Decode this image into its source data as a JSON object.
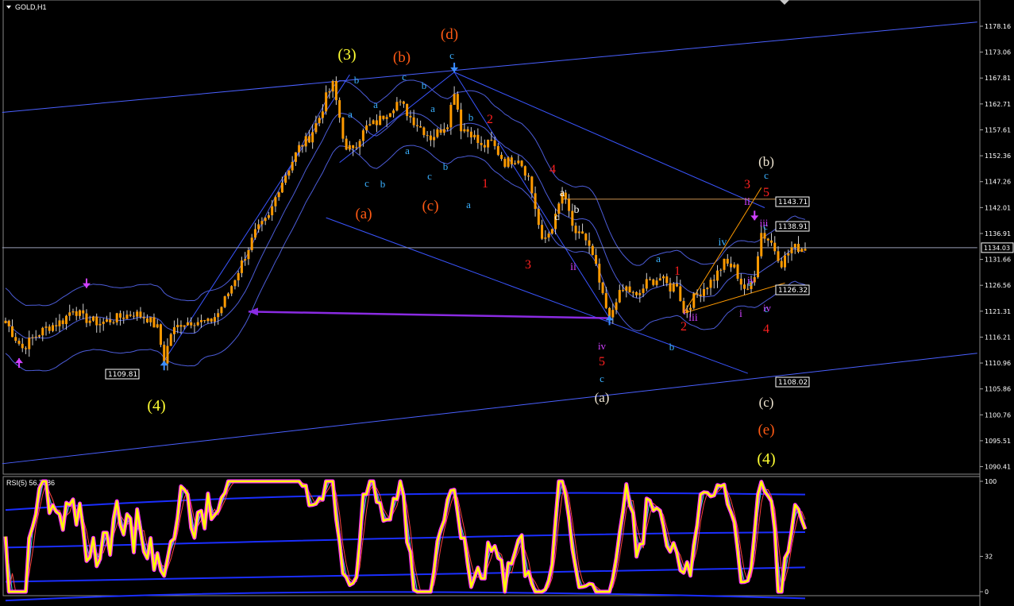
{
  "window": {
    "symbol_label": "GOLD,H1",
    "rsi_label": "RSI(5) 56.7186"
  },
  "chart_data": [
    {
      "type": "candlestick",
      "title": "GOLD,H1",
      "price_axis_ticks": [
        "1178.16",
        "1173.06",
        "1167.81",
        "1162.71",
        "1157.61",
        "1152.36",
        "1147.26",
        "1142.01",
        "1136.91",
        "1131.66",
        "1126.56",
        "1121.31",
        "1116.21",
        "1110.96",
        "1105.86",
        "1100.76",
        "1095.51",
        "1090.41"
      ],
      "ylim": [
        1090.41,
        1181.0
      ],
      "current_price": "1134.03",
      "price_tags": [
        "1143.71",
        "1138.91",
        "1126.32",
        "1109.81",
        "1108.02"
      ],
      "close_path": [
        [
          0,
          1119.5
        ],
        [
          2,
          1117
        ],
        [
          5,
          1114
        ],
        [
          8,
          1116
        ],
        [
          12,
          1118
        ],
        [
          17,
          1119.5
        ],
        [
          20,
          1122
        ],
        [
          23,
          1120
        ],
        [
          28,
          1119
        ],
        [
          33,
          1120
        ],
        [
          38,
          1121
        ],
        [
          42,
          1120
        ],
        [
          45,
          1118
        ],
        [
          47,
          1111.5
        ],
        [
          49,
          1117
        ],
        [
          52,
          1119
        ],
        [
          56,
          1119.5
        ],
        [
          60,
          1119
        ],
        [
          63,
          1121
        ],
        [
          66,
          1125
        ],
        [
          70,
          1131
        ],
        [
          74,
          1137
        ],
        [
          78,
          1140
        ],
        [
          81,
          1146
        ],
        [
          84,
          1150
        ],
        [
          87,
          1154
        ],
        [
          90,
          1156
        ],
        [
          93,
          1160
        ],
        [
          95,
          1164
        ],
        [
          97,
          1166.5
        ],
        [
          99,
          1160
        ],
        [
          101,
          1153
        ],
        [
          104,
          1155
        ],
        [
          107,
          1158
        ],
        [
          110,
          1159
        ],
        [
          113,
          1161
        ],
        [
          116,
          1163
        ],
        [
          118,
          1162
        ],
        [
          120,
          1160
        ],
        [
          123,
          1158
        ],
        [
          126,
          1156
        ],
        [
          128,
          1157
        ],
        [
          131,
          1159
        ],
        [
          133,
          1165.5
        ],
        [
          135,
          1158
        ],
        [
          138,
          1157
        ],
        [
          141,
          1154
        ],
        [
          144,
          1155
        ],
        [
          148,
          1151
        ],
        [
          152,
          1152
        ],
        [
          155,
          1148
        ],
        [
          157,
          1142
        ],
        [
          159,
          1135
        ],
        [
          161,
          1137
        ],
        [
          163,
          1140
        ],
        [
          165,
          1145
        ],
        [
          167,
          1141
        ],
        [
          169,
          1136
        ],
        [
          171,
          1137
        ],
        [
          173,
          1134
        ],
        [
          175,
          1130
        ],
        [
          177,
          1124
        ],
        [
          179,
          1119.5
        ],
        [
          181,
          1124
        ],
        [
          184,
          1126
        ],
        [
          187,
          1124
        ],
        [
          190,
          1127
        ],
        [
          194,
          1128
        ],
        [
          197,
          1126
        ],
        [
          199,
          1127
        ],
        [
          201,
          1121
        ],
        [
          204,
          1124
        ],
        [
          207,
          1126
        ],
        [
          210,
          1128
        ],
        [
          213,
          1131
        ],
        [
          216,
          1130
        ],
        [
          218,
          1127
        ],
        [
          220,
          1125
        ],
        [
          222,
          1129
        ],
        [
          224,
          1137
        ],
        [
          227,
          1135
        ],
        [
          230,
          1131
        ],
        [
          233,
          1134
        ],
        [
          237,
          1134
        ]
      ],
      "wave_labels": [
        {
          "text": "(3)",
          "color": "#ffff33"
        },
        {
          "text": "(4)",
          "color": "#ffff33"
        },
        {
          "text": "(4)",
          "color": "#ffff33"
        },
        {
          "text": "(d)",
          "color": "#ff5a14"
        },
        {
          "text": "(b)",
          "color": "#ff5a14"
        },
        {
          "text": "(a)",
          "color": "#ff5a14"
        },
        {
          "text": "(c)",
          "color": "#ff5a14"
        },
        {
          "text": "(e)",
          "color": "#ff5a14"
        },
        {
          "text": "(b)",
          "color": "#f0e6d2"
        },
        {
          "text": "(a)",
          "color": "#f0e6d2"
        },
        {
          "text": "(c)",
          "color": "#f0e6d2"
        },
        {
          "text": "1",
          "color": "#ff2020"
        },
        {
          "text": "2",
          "color": "#ff2020"
        },
        {
          "text": "3",
          "color": "#ff2020"
        },
        {
          "text": "4",
          "color": "#ff2020"
        },
        {
          "text": "5",
          "color": "#ff2020"
        },
        {
          "text": "1",
          "color": "#ff2020"
        },
        {
          "text": "2",
          "color": "#ff2020"
        },
        {
          "text": "3",
          "color": "#ff2020"
        },
        {
          "text": "4",
          "color": "#ff2020"
        },
        {
          "text": "5",
          "color": "#ff2020"
        },
        {
          "text": "a",
          "color": "#3ab0ff"
        },
        {
          "text": "b",
          "color": "#3ab0ff"
        },
        {
          "text": "c",
          "color": "#3ab0ff"
        },
        {
          "text": "a",
          "color": "#3ab0ff"
        },
        {
          "text": "b",
          "color": "#3ab0ff"
        },
        {
          "text": "c",
          "color": "#3ab0ff"
        },
        {
          "text": "a",
          "color": "#3ab0ff"
        },
        {
          "text": "b",
          "color": "#3ab0ff"
        },
        {
          "text": "c",
          "color": "#3ab0ff"
        },
        {
          "text": "a",
          "color": "#3ab0ff"
        },
        {
          "text": "b",
          "color": "#3ab0ff"
        },
        {
          "text": "c",
          "color": "#3ab0ff"
        },
        {
          "text": "b",
          "color": "#3ab0ff"
        },
        {
          "text": "a",
          "color": "#3ab0ff"
        },
        {
          "text": "c",
          "color": "#3ab0ff"
        },
        {
          "text": "a",
          "color": "#3ab0ff"
        },
        {
          "text": "b",
          "color": "#3ab0ff"
        },
        {
          "text": "c",
          "color": "#3ab0ff"
        },
        {
          "text": "c",
          "color": "#3ab0ff"
        },
        {
          "text": "b",
          "color": "#3ab0ff"
        },
        {
          "text": "c",
          "color": "#3ab0ff"
        },
        {
          "text": "a",
          "color": "#ffffff"
        },
        {
          "text": "b",
          "color": "#ffffff"
        },
        {
          "text": "c",
          "color": "#ffffff"
        },
        {
          "text": "ii",
          "color": "#d040ff"
        },
        {
          "text": "iv",
          "color": "#d040ff"
        },
        {
          "text": "i",
          "color": "#d040ff"
        },
        {
          "text": "iii",
          "color": "#d040ff"
        },
        {
          "text": "iv",
          "color": "#3ab0ff"
        },
        {
          "text": "i",
          "color": "#d040ff"
        },
        {
          "text": "ii",
          "color": "#d040ff"
        },
        {
          "text": "iii",
          "color": "#d040ff"
        },
        {
          "text": "iv",
          "color": "#d040ff"
        },
        {
          "text": "iv",
          "color": "#d040ff"
        }
      ],
      "grid": false,
      "legend": "none"
    },
    {
      "type": "line",
      "title": "RSI(5) 56.7186",
      "ylim": [
        0,
        100
      ],
      "y_ticks": [
        "100",
        "32",
        "0"
      ],
      "series": [
        {
          "name": "RSI(5)",
          "current": 56.7186,
          "color": "#ffff00"
        }
      ]
    }
  ],
  "colors": {
    "background": "#000000",
    "candle": "#ff9a00",
    "bands": "#4c5cd8",
    "channel": "#4a60ff",
    "purple_arrow": "#8a2be2",
    "rsi_main": "#ffff00",
    "rsi_glow": "#ff33ff",
    "rsi_bands": "#1a2eff"
  },
  "icons": [
    "dropdown-triangle-icon",
    "up-arrow-icon",
    "down-arrow-icon",
    "left-arrow-icon"
  ]
}
